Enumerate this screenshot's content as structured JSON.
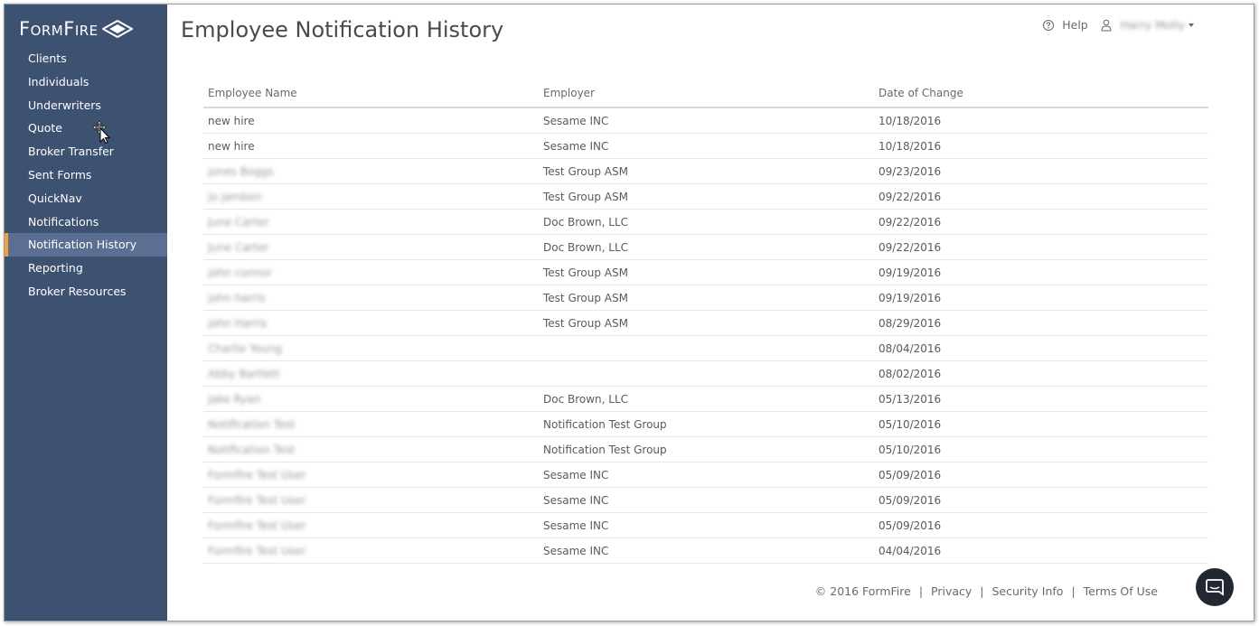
{
  "brand": {
    "name": "FormFire"
  },
  "sidebar": {
    "items": [
      {
        "label": "Clients"
      },
      {
        "label": "Individuals"
      },
      {
        "label": "Underwriters"
      },
      {
        "label": "Quote"
      },
      {
        "label": "Broker Transfer"
      },
      {
        "label": "Sent Forms"
      },
      {
        "label": "QuickNav"
      },
      {
        "label": "Notifications"
      },
      {
        "label": "Notification History",
        "active": true
      },
      {
        "label": "Reporting"
      },
      {
        "label": "Broker Resources"
      }
    ]
  },
  "header": {
    "title": "Employee Notification History",
    "help_label": "Help",
    "user_name": "Harry Molly"
  },
  "table": {
    "columns": [
      "Employee Name",
      "Employer",
      "Date of Change"
    ],
    "rows": [
      {
        "name": "new hire",
        "employer": "Sesame INC",
        "date": "10/18/2016",
        "name_blurred": false
      },
      {
        "name": "new hire",
        "employer": "Sesame INC",
        "date": "10/18/2016",
        "name_blurred": false
      },
      {
        "name": "jones Boggs",
        "employer": "Test Group ASM",
        "date": "09/23/2016",
        "name_blurred": true
      },
      {
        "name": "jo jambon",
        "employer": "Test Group ASM",
        "date": "09/22/2016",
        "name_blurred": true
      },
      {
        "name": "June Carter",
        "employer": "Doc Brown, LLC",
        "date": "09/22/2016",
        "name_blurred": true
      },
      {
        "name": "June Carter",
        "employer": "Doc Brown, LLC",
        "date": "09/22/2016",
        "name_blurred": true
      },
      {
        "name": "john connor",
        "employer": "Test Group ASM",
        "date": "09/19/2016",
        "name_blurred": true
      },
      {
        "name": "john harris",
        "employer": "Test Group ASM",
        "date": "09/19/2016",
        "name_blurred": true
      },
      {
        "name": "john Harris",
        "employer": "Test Group ASM",
        "date": "08/29/2016",
        "name_blurred": true
      },
      {
        "name": "Charlie Young",
        "employer": "",
        "date": "08/04/2016",
        "name_blurred": true
      },
      {
        "name": "Abby Bartlett",
        "employer": "",
        "date": "08/02/2016",
        "name_blurred": true
      },
      {
        "name": "Jake Ryan",
        "employer": "Doc Brown, LLC",
        "date": "05/13/2016",
        "name_blurred": true
      },
      {
        "name": "Notification Test",
        "employer": "Notification Test Group",
        "date": "05/10/2016",
        "name_blurred": true
      },
      {
        "name": "Notification Test",
        "employer": "Notification Test Group",
        "date": "05/10/2016",
        "name_blurred": true
      },
      {
        "name": "Formfire Test User",
        "employer": "Sesame INC",
        "date": "05/09/2016",
        "name_blurred": true
      },
      {
        "name": "Formfire Test User",
        "employer": "Sesame INC",
        "date": "05/09/2016",
        "name_blurred": true
      },
      {
        "name": "Formfire Test User",
        "employer": "Sesame INC",
        "date": "05/09/2016",
        "name_blurred": true
      },
      {
        "name": "Formfire Test User",
        "employer": "Sesame INC",
        "date": "04/04/2016",
        "name_blurred": true
      }
    ]
  },
  "footer": {
    "copyright": "© 2016 FormFire",
    "links": [
      "Privacy",
      "Security Info",
      "Terms Of Use"
    ],
    "separator": "|"
  },
  "icons": {
    "logo": "diamond-logo-icon",
    "help": "question-circle-icon",
    "user": "user-icon",
    "chat": "chat-bubble-icon",
    "cursor": "move-cursor-icon"
  },
  "colors": {
    "sidebar_bg": "#3d5170",
    "sidebar_active_bg": "#5a6f92",
    "active_accent": "#f4a13c",
    "chat_button": "#222831"
  }
}
